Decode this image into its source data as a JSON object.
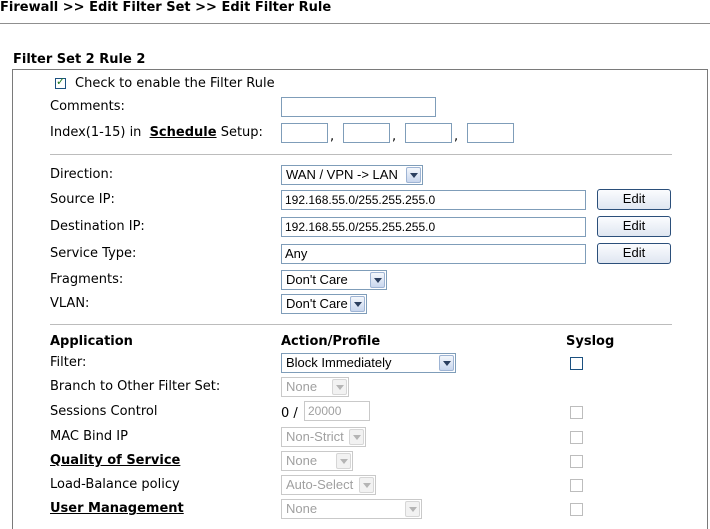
{
  "breadcrumb": "Firewall >> Edit Filter Set >> Edit Filter Rule",
  "section_title": "Filter Set 2 Rule 2",
  "enable": {
    "label": "Check to enable the Filter Rule",
    "checked": true
  },
  "comments": {
    "label": "Comments:",
    "value": ""
  },
  "schedule": {
    "prefix": "Index(1-15) in",
    "link": "Schedule",
    "suffix": "Setup:",
    "values": [
      "",
      "",
      "",
      ""
    ],
    "separator": ","
  },
  "direction": {
    "label": "Direction:",
    "value": "WAN / VPN -> LAN"
  },
  "source_ip": {
    "label": "Source IP:",
    "value": "192.168.55.0/255.255.255.0",
    "button": "Edit"
  },
  "dest_ip": {
    "label": "Destination IP:",
    "value": "192.168.55.0/255.255.255.0",
    "button": "Edit"
  },
  "service_type": {
    "label": "Service Type:",
    "value": "Any",
    "button": "Edit"
  },
  "fragments": {
    "label": "Fragments:",
    "value": "Don't Care"
  },
  "vlan": {
    "label": "VLAN:",
    "value": "Don't Care"
  },
  "table_headers": {
    "application": "Application",
    "action": "Action/Profile",
    "syslog": "Syslog"
  },
  "rows": {
    "filter": {
      "label": "Filter:",
      "value": "Block Immediately"
    },
    "branch": {
      "label": "Branch to Other Filter Set:",
      "value": "None"
    },
    "sessions": {
      "label": "Sessions Control",
      "current": "0",
      "sep": "/",
      "max": "20000"
    },
    "mac_bind": {
      "label": "MAC Bind IP",
      "value": "Non-Strict"
    },
    "qos": {
      "label": "Quality of Service",
      "value": "None"
    },
    "load_balance": {
      "label": "Load-Balance policy",
      "value": "Auto-Select"
    },
    "user_mgmt": {
      "label": "User Management",
      "value": "None"
    }
  },
  "colors": {
    "input_border": "#7f9db9",
    "button_border": "#2b4f7a",
    "checkbox_border": "#1c5180",
    "disabled_text": "#a0a0a0"
  }
}
